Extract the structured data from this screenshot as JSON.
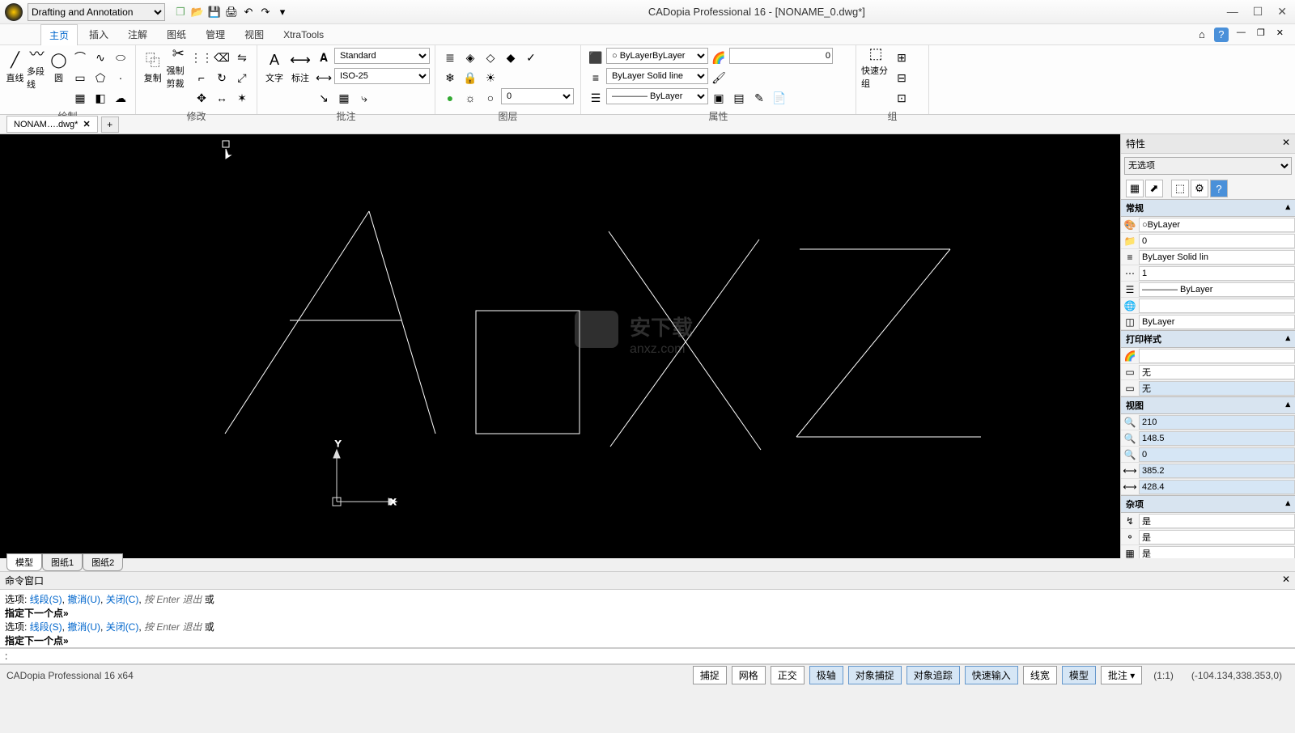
{
  "title": "CADopia Professional 16 - [NONAME_0.dwg*]",
  "workspace": "Drafting and Annotation",
  "menus": {
    "home": "主页",
    "insert": "插入",
    "annotate": "注解",
    "drawing": "图纸",
    "manage": "管理",
    "view": "视图",
    "xtra": "XtraTools"
  },
  "ribbon": {
    "draw": {
      "label": "绘制",
      "line": "直线",
      "polyline": "多段线",
      "circle": "圆",
      "arc": "弧"
    },
    "modify": {
      "label": "修改",
      "copy": "复制",
      "trim": "强制剪裁"
    },
    "annot": {
      "label": "批注",
      "text": "文字",
      "dim": "标注",
      "style": "Standard",
      "dimstyle": "ISO-25"
    },
    "layer": {
      "label": "图层",
      "cur": "0"
    },
    "props": {
      "label": "属性",
      "color": "ByLayer",
      "ltype": "ByLayer   Solid line",
      "lweight": "———— ByLayer",
      "val": "0"
    },
    "group": {
      "label": "组",
      "quick": "快速分组"
    }
  },
  "docTab": "NONAM….dwg*",
  "sheets": {
    "model": "模型",
    "s1": "图纸1",
    "s2": "图纸2"
  },
  "propsPanel": {
    "title": "特性",
    "selection": "无选项",
    "cat_general": "常规",
    "cat_print": "打印样式",
    "cat_view": "视图",
    "cat_misc": "杂项",
    "bylayer": "ByLayer",
    "layer0": "0",
    "solidline": "ByLayer     Solid lin",
    "one": "1",
    "dashByLayer": "———— ByLayer",
    "none": "无",
    "v1": "210",
    "v2": "148.5",
    "v3": "0",
    "v4": "385.2",
    "v5": "428.4",
    "yes": "是"
  },
  "cmd": {
    "title": "命令窗口",
    "opts_prefix": "选项: ",
    "seg": "线段(S)",
    "undo": "撤消(U)",
    "close": "关闭(C)",
    "enter": "按 Enter 退出",
    "or": "或",
    "prompt": "指定下一个点»",
    "input": ":"
  },
  "status": {
    "app": "CADopia Professional 16 x64",
    "snap": "捕捉",
    "grid": "网格",
    "ortho": "正交",
    "polar": "极轴",
    "osnap": "对象捕捉",
    "otrack": "对象追踪",
    "qinput": "快速输入",
    "lw": "线宽",
    "model": "模型",
    "annot": "批注",
    "scale": "(1:1)",
    "coords": "(-104.134,338.353,0)"
  },
  "watermark": "安下载 anxz.com"
}
